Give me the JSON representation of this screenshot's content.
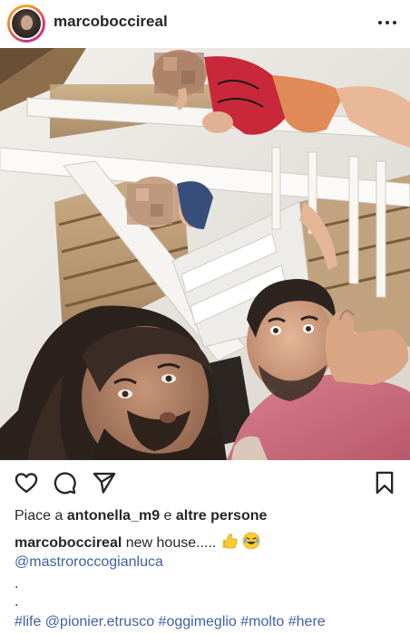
{
  "post": {
    "username": "marcoboccireal",
    "more_icon": "ellipsis-icon",
    "image_alt": "Selfie of two men under a white wooden staircase with two children leaning over the railing",
    "likes": {
      "prefix": "Piace a",
      "user": "antonella_m9",
      "joiner": "e",
      "others": "altre persone"
    },
    "caption": {
      "username": "marcoboccireal",
      "text": "new house.....",
      "emojis": [
        "thumbs-up-emoji",
        "laughing-emoji"
      ]
    },
    "mention_line": "@mastroroccogianluca",
    "dots": [
      ".",
      "."
    ],
    "hashtag_line": "#life @pionier.etrusco #oggimeglio #molto #here"
  },
  "icons": {
    "like": "heart-icon",
    "comment": "comment-icon",
    "share": "send-icon",
    "save": "bookmark-icon"
  },
  "colors": {
    "text": "#262626",
    "link": "#3f61a6",
    "background": "#ffffff"
  }
}
